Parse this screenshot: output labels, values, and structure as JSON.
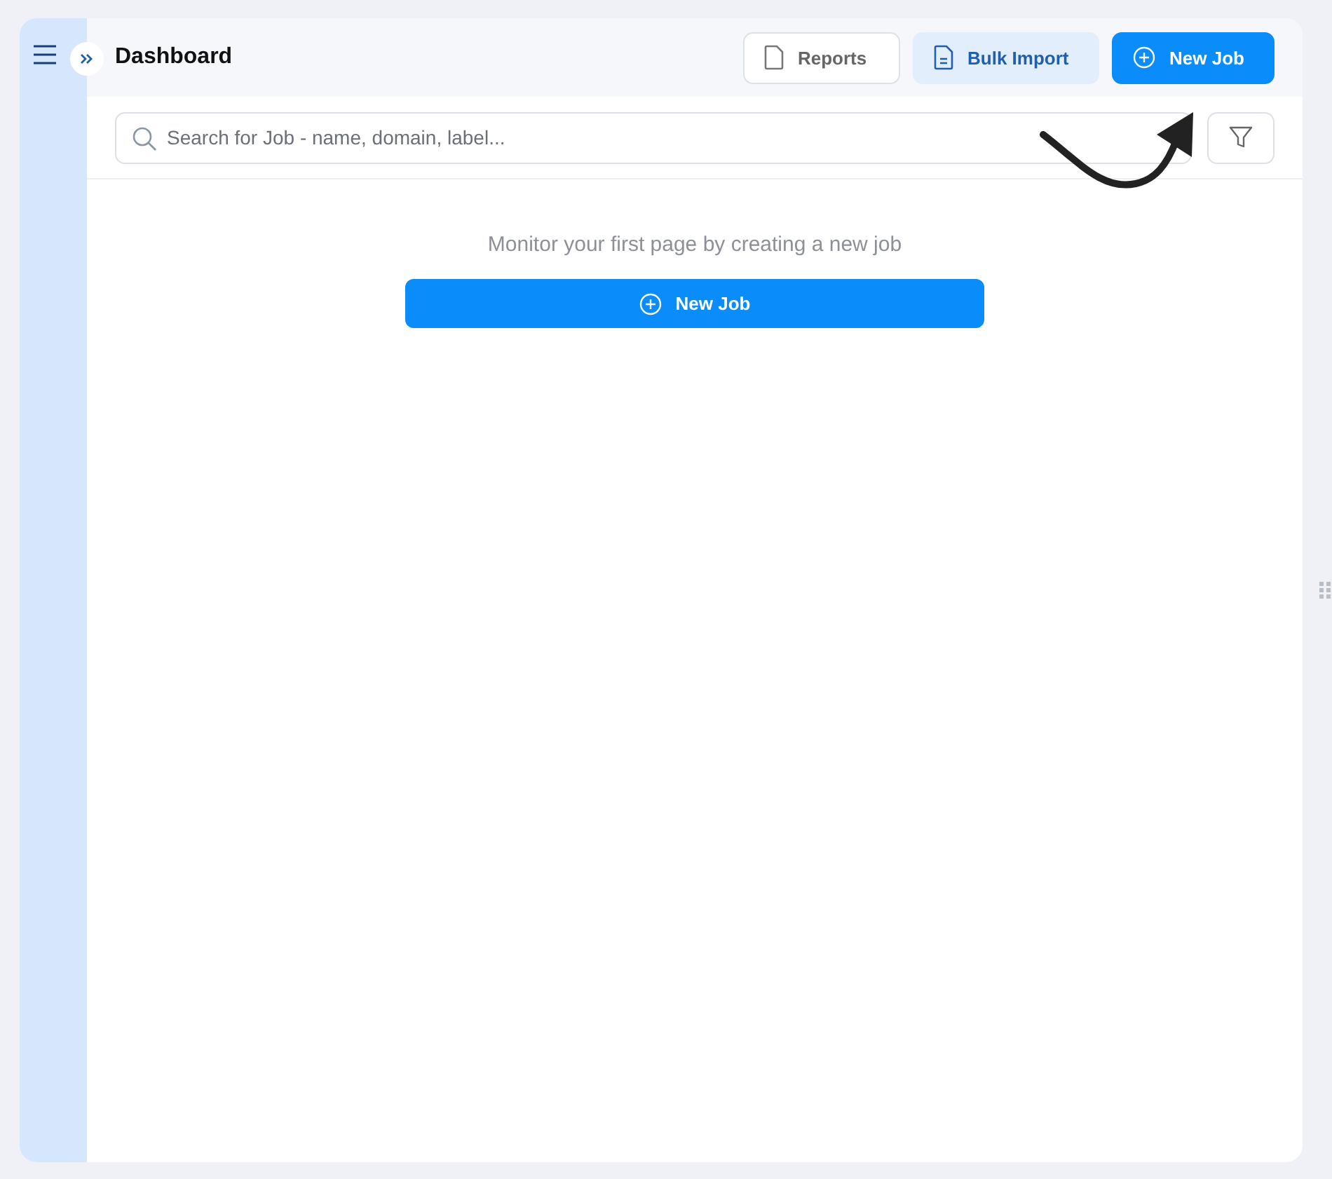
{
  "header": {
    "title": "Dashboard",
    "actions": [
      {
        "label": "Reports",
        "kind": "outline"
      },
      {
        "label": "Bulk Import",
        "kind": "soft"
      },
      {
        "label": "New Job",
        "kind": "primary"
      }
    ]
  },
  "search": {
    "placeholder": "Search for Job - name, domain, label..."
  },
  "empty_state": {
    "message": "Monitor your first page by creating a new job",
    "button": "New Job"
  }
}
